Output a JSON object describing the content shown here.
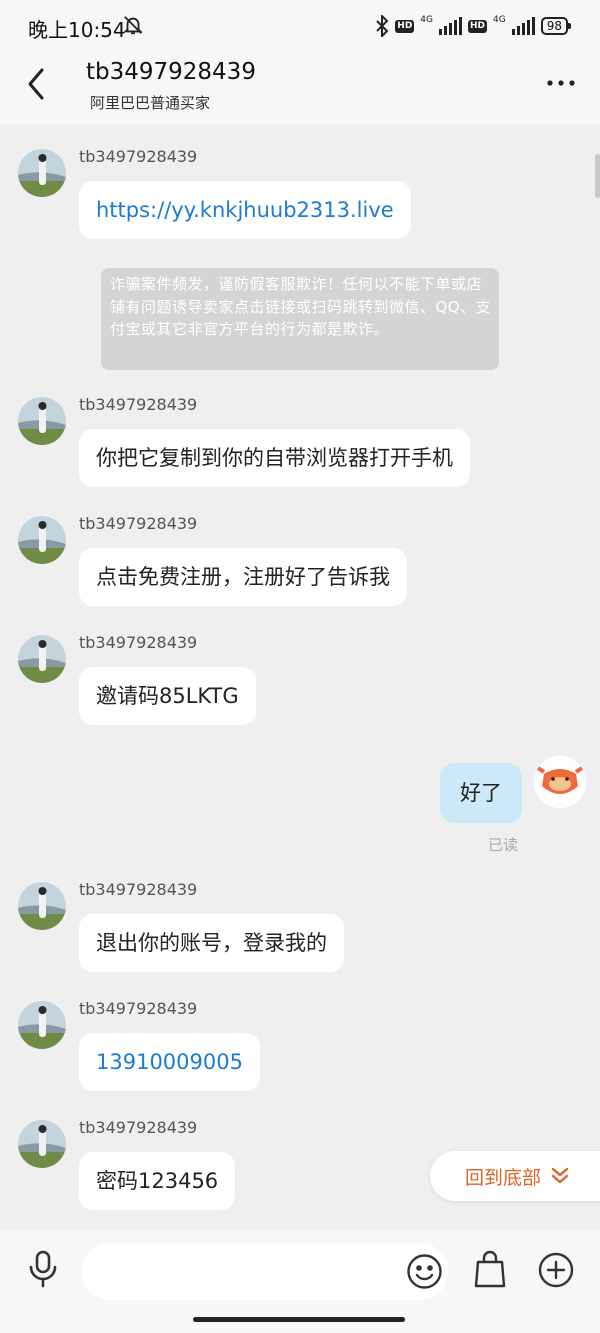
{
  "status_bar": {
    "time": "晚上10:54",
    "hd1": "HD",
    "net1": "4G",
    "hd2": "HD",
    "net2": "4G",
    "battery": "98"
  },
  "header": {
    "title": "tb3497928439",
    "subtitle": "阿里巴巴普通买家"
  },
  "messages": [
    {
      "sender": "tb3497928439",
      "text": "https://yy.knkjhuub2313.live"
    },
    {
      "sender": "tb3497928439",
      "text": "你把它复制到你的自带浏览器打开手机"
    },
    {
      "sender": "tb3497928439",
      "text": "点击免费注册，注册好了告诉我"
    },
    {
      "sender": "tb3497928439",
      "text": "邀请码85LKTG"
    },
    {
      "sender": "tb3497928439",
      "text": "退出你的账号，登录我的"
    },
    {
      "sender": "tb3497928439",
      "text": "13910009005"
    },
    {
      "sender": "tb3497928439",
      "text": "密码123456"
    }
  ],
  "system_notice": "诈骗案件频发，谨防假客服欺诈！任何以不能下单或店铺有问题诱导卖家点击链接或扫码跳转到微信、QQ、支付宝或其它非官方平台的行为都是欺诈。",
  "my_message": {
    "text": "好了",
    "status": "已读"
  },
  "to_bottom": {
    "label": "回到底部"
  },
  "colors": {
    "link": "#1b7bd6",
    "my_bubble": "#cde8f8",
    "accent_orange": "#e0612a",
    "notice_bg": "#d4d4d4"
  },
  "icons": [
    "back-arrow-icon",
    "more-icon",
    "bell-off-icon",
    "bluetooth-icon",
    "microphone-icon",
    "emoji-icon",
    "shopping-bag-icon",
    "plus-circle-icon",
    "chevron-double-down-icon"
  ]
}
